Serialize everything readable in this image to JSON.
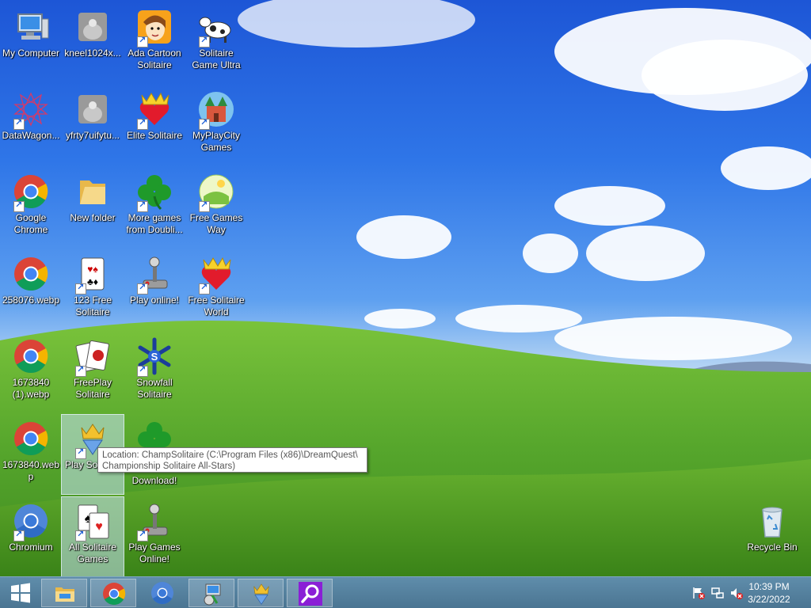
{
  "desktop_icons": [
    {
      "label": "My Computer"
    },
    {
      "label": "kneel1024x..."
    },
    {
      "label": "Ada Cartoon Solitaire"
    },
    {
      "label": "Solitaire Game Ultra"
    },
    {
      "label": "DataWagon..."
    },
    {
      "label": "yfrty7uifytu..."
    },
    {
      "label": "Elite Solitaire"
    },
    {
      "label": "MyPlayCity Games"
    },
    {
      "label": "Google Chrome"
    },
    {
      "label": "New folder"
    },
    {
      "label": "More games from Doubli..."
    },
    {
      "label": "Free Games Way"
    },
    {
      "label": "258076.webp"
    },
    {
      "label": "123 Free Solitaire"
    },
    {
      "label": "Play online!"
    },
    {
      "label": "Free Solitaire World"
    },
    {
      "label": "1673840 (1).webp"
    },
    {
      "label": "FreePlay Solitaire"
    },
    {
      "label": "Snowfall Solitaire"
    },
    {
      "label": "1673840.webp"
    },
    {
      "label": "Play Solitaire"
    },
    {
      "label": "Download!"
    },
    {
      "label": "Chromium"
    },
    {
      "label": "All Solitaire Games"
    },
    {
      "label": "Play Games Online!"
    },
    {
      "label": "Recycle Bin"
    }
  ],
  "tooltip": {
    "line1": "Location: ChampSolitaire (C:\\Program Files (x86)\\DreamQuest\\",
    "line2": "Championship Solitaire All-Stars)"
  },
  "taskbar": {
    "items": [
      "start-icon",
      "file-explorer-icon",
      "chrome-icon",
      "chromium-icon",
      "installer-icon",
      "solitaire-crown-icon",
      "search-magnifier-icon"
    ],
    "clock": {
      "time": "10:39 PM",
      "date": "3/22/2022"
    }
  },
  "colors": {
    "taskbar": "#5583a3",
    "sky": "#2f76e8",
    "grass": "#4f9a2b"
  }
}
